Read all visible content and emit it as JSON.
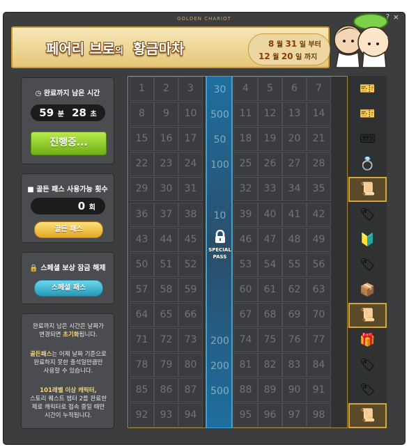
{
  "window": {
    "title": "GOLDEN CHARIOT",
    "help": "?",
    "close": "×"
  },
  "banner": {
    "title_a": "페어리 브로",
    "title_b": "의",
    "title_c": "황금마차",
    "date1_month": "8",
    "date1_m_unit": "월",
    "date1_day": "31",
    "date1_d_unit": "일 부터",
    "date2_month": "12",
    "date2_m_unit": "월",
    "date2_day": "20",
    "date2_d_unit": "일 까지"
  },
  "timer": {
    "label": "완료까지 남은 시간",
    "minutes": "59",
    "min_unit": "분",
    "seconds": "28",
    "sec_unit": "초",
    "button": "진행중..."
  },
  "golden_pass": {
    "label": "골든 패스 사용가능 횟수",
    "count": "0",
    "count_unit": "회",
    "button": "골든 패스"
  },
  "special": {
    "label": "스페셜 보상 잠금 해제",
    "button": "스페셜 패스",
    "lock_text": "SPECIAL PASS"
  },
  "notes": {
    "n1a": "완료까지 남은 시간은 날짜가",
    "n1b": "변경되면 ",
    "n1b_bold": "초기화",
    "n1c": "됩니다.",
    "n2_bold": "골든패스",
    "n2a": "는 어제 날짜 기준으로",
    "n2b": "완료하지 못한 출석일만큼만",
    "n2c": "사용할 수 있습니다.",
    "n3_bold": "101레벨 이상 캐릭터,",
    "n3a": "스토리 퀘스트 챕터 2를 완료한",
    "n3b": "제로 캐릭터로 접속 중일 때만",
    "n3c": "시간이 누적됩니다."
  },
  "grid_rows": [
    [
      1,
      2,
      3,
      4,
      5,
      6,
      7
    ],
    [
      8,
      9,
      10,
      11,
      12,
      13,
      14
    ],
    [
      15,
      16,
      17,
      18,
      19,
      20,
      21
    ],
    [
      22,
      23,
      24,
      25,
      26,
      27,
      28
    ],
    [
      29,
      30,
      31,
      32,
      33,
      34,
      35
    ],
    [
      36,
      37,
      38,
      39,
      40,
      41,
      42
    ],
    [
      43,
      44,
      45,
      46,
      47,
      48,
      49
    ],
    [
      50,
      51,
      52,
      53,
      54,
      55,
      56
    ],
    [
      57,
      58,
      59,
      60,
      61,
      62,
      63
    ],
    [
      64,
      65,
      66,
      67,
      68,
      69,
      70
    ],
    [
      71,
      72,
      73,
      74,
      75,
      76,
      77
    ],
    [
      78,
      79,
      80,
      81,
      82,
      83,
      84
    ],
    [
      85,
      86,
      87,
      88,
      89,
      90,
      91
    ],
    [
      92,
      93,
      94,
      95,
      96,
      97,
      98
    ]
  ],
  "special_column": [
    "30",
    "500",
    "50",
    "100",
    "",
    "10",
    "",
    "",
    "",
    "",
    "200",
    "200",
    "500",
    ""
  ],
  "reward_icons": [
    "coupon",
    "coupon",
    "ticket",
    "ring",
    "scroll",
    "nameplate",
    "badge",
    "nameplate",
    "box",
    "scroll",
    "chest",
    "nameplate",
    "nameplate",
    "scroll"
  ],
  "highlight_rows": [
    4,
    9,
    13
  ],
  "colors": {
    "gold": "#d4a63c",
    "blue": "#3aa3d8",
    "green": "#7fc021"
  }
}
